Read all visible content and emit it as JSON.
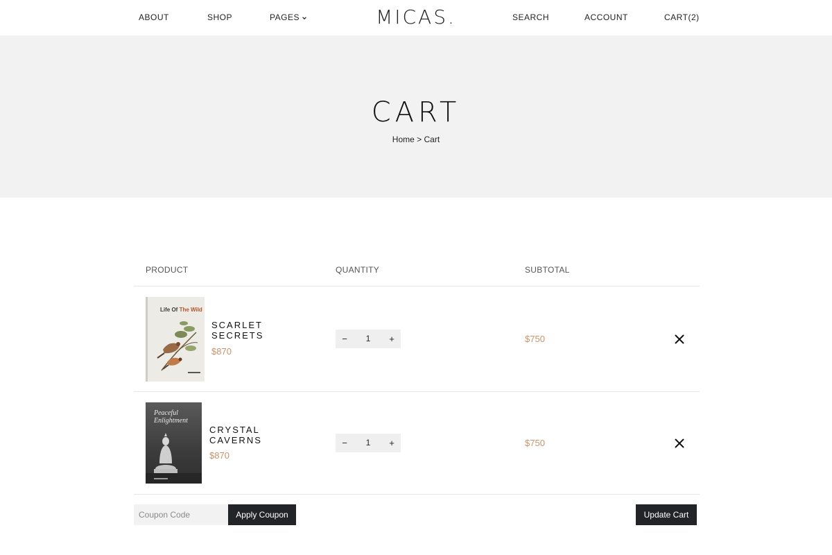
{
  "header": {
    "nav_left": [
      {
        "label": "ABOUT"
      },
      {
        "label": "SHOP"
      },
      {
        "label": "PAGES"
      }
    ],
    "logo": "MICAS.",
    "nav_right": [
      {
        "label": "SEARCH"
      },
      {
        "label": "ACCOUNT"
      },
      {
        "label": "CART(2)"
      }
    ]
  },
  "hero": {
    "title": "CART",
    "breadcrumb": {
      "home": "Home",
      "separator": ">",
      "current": "Cart"
    }
  },
  "table": {
    "columns": [
      "PRODUCT",
      "QUANTITY",
      "SUBTOTAL"
    ],
    "rows": [
      {
        "name_line1": "SCARLET",
        "name_line2": "SECRETS",
        "price": "$870",
        "quantity": "1",
        "subtotal": "$750",
        "cover_title_a": "Life Of ",
        "cover_title_b": "The Wild"
      },
      {
        "name_line1": "CRYSTAL",
        "name_line2": "CAVERNS",
        "price": "$870",
        "quantity": "1",
        "subtotal": "$750",
        "cover_title_a": "Peaceful",
        "cover_title_b": "Enlightment"
      }
    ]
  },
  "coupon": {
    "placeholder": "Coupon Code",
    "apply_label": "Apply Coupon"
  },
  "update_label": "Update Cart",
  "colors": {
    "accent_price": "#c8936a",
    "hero_bg": "#f2f2f2",
    "button_bg": "#222428"
  }
}
